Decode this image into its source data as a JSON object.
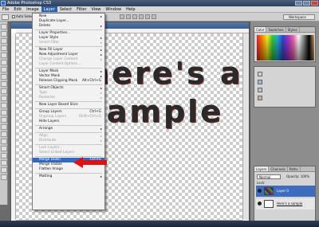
{
  "window": {
    "title": "Adobe Photoshop CS3"
  },
  "menubar": [
    "File",
    "Edit",
    "Image",
    "Layer",
    "Select",
    "Filter",
    "View",
    "Window",
    "Help"
  ],
  "options": {
    "auto_select": "Auto Select:",
    "workspace": "Workspace"
  },
  "canvas": {
    "line1": "here's a",
    "line2": "sample",
    "status": "Doc: 1.11M/1.89M"
  },
  "layer_menu": {
    "items": [
      {
        "label": "New",
        "arrow": true
      },
      {
        "label": "Duplicate Layer..."
      },
      {
        "label": "Delete",
        "arrow": true
      },
      {
        "sep": true
      },
      {
        "label": "Layer Properties..."
      },
      {
        "label": "Layer Style",
        "arrow": true
      },
      {
        "label": "Smart Filter",
        "disabled": true,
        "arrow": true
      },
      {
        "sep": true
      },
      {
        "label": "New Fill Layer",
        "arrow": true
      },
      {
        "label": "New Adjustment Layer",
        "arrow": true
      },
      {
        "label": "Change Layer Content",
        "disabled": true,
        "arrow": true
      },
      {
        "label": "Layer Content Options...",
        "disabled": true
      },
      {
        "sep": true
      },
      {
        "label": "Layer Mask",
        "arrow": true
      },
      {
        "label": "Vector Mask",
        "arrow": true
      },
      {
        "label": "Release Clipping Mask",
        "shortcut": "Alt+Ctrl+G"
      },
      {
        "sep": true
      },
      {
        "label": "Smart Objects",
        "arrow": true
      },
      {
        "label": "Type",
        "disabled": true,
        "arrow": true
      },
      {
        "label": "Rasterize",
        "disabled": true,
        "arrow": true
      },
      {
        "sep": true
      },
      {
        "label": "New Layer Based Slice"
      },
      {
        "sep": true
      },
      {
        "label": "Group Layers",
        "shortcut": "Ctrl+G"
      },
      {
        "label": "Ungroup Layers",
        "disabled": true,
        "shortcut": "Shift+Ctrl+G"
      },
      {
        "label": "Hide Layers"
      },
      {
        "sep": true
      },
      {
        "label": "Arrange",
        "arrow": true
      },
      {
        "sep": true
      },
      {
        "label": "Align",
        "disabled": true,
        "arrow": true
      },
      {
        "label": "Distribute",
        "disabled": true,
        "arrow": true
      },
      {
        "sep": true
      },
      {
        "label": "Lock Layers...",
        "disabled": true
      },
      {
        "label": "Select Linked Layers",
        "disabled": true
      },
      {
        "sep": true
      },
      {
        "label": "Merge Down",
        "highlight": true,
        "shortcut": "Ctrl+E"
      },
      {
        "label": "Merge Visible",
        "shortcut": "Shift+Ctrl+E"
      },
      {
        "label": "Flatten Image"
      },
      {
        "sep": true
      },
      {
        "label": "Matting",
        "arrow": true
      }
    ]
  },
  "panels": {
    "color_tabs": [
      "Color",
      "Swatches",
      "Styles"
    ],
    "layers_tabs": [
      "Layers",
      "Channels",
      "Paths"
    ],
    "blend_mode": "Normal",
    "opacity": "Opacity: 100%",
    "lock": "Lock:",
    "fill": "Fill: 100%",
    "layers": [
      {
        "name": "Layer 0",
        "selected": true
      },
      {
        "name": "Here's a sample",
        "selected": false
      }
    ]
  },
  "colors": {
    "highlight": "#316ac5",
    "arrow_red": "#e01010",
    "selected_layer": "#3e6cc0"
  }
}
